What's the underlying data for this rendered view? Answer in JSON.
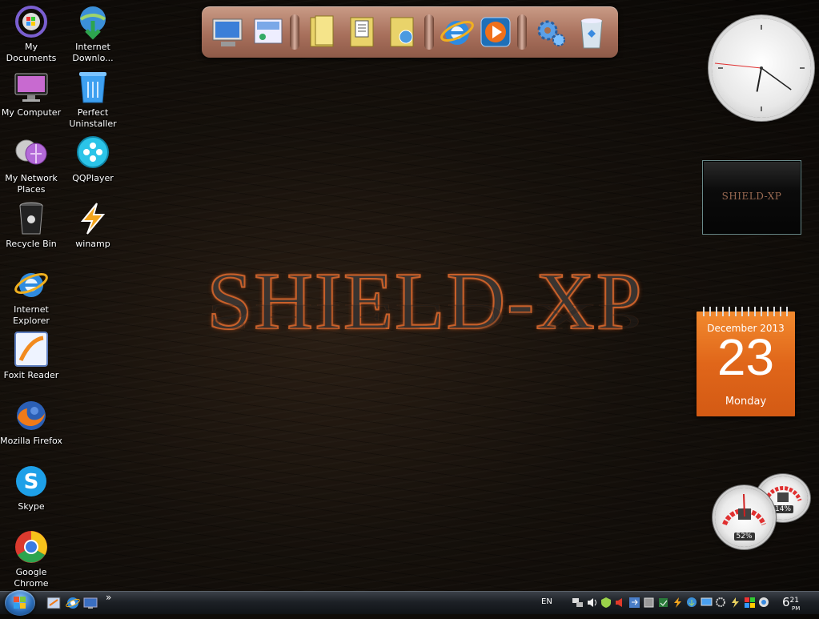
{
  "desktop": {
    "icons_left": [
      {
        "label": "My Documents",
        "icon": "my-documents-icon"
      },
      {
        "label": "My Computer",
        "icon": "my-computer-icon"
      },
      {
        "label": "My Network Places",
        "icon": "network-places-icon"
      },
      {
        "label": "Recycle Bin",
        "icon": "recycle-bin-icon"
      },
      {
        "label": "Internet Explorer",
        "icon": "internet-explorer-icon"
      },
      {
        "label": "Foxit Reader",
        "icon": "foxit-reader-icon"
      },
      {
        "label": "Mozilla Firefox",
        "icon": "firefox-icon"
      },
      {
        "label": "Skype",
        "icon": "skype-icon"
      },
      {
        "label": "Google Chrome",
        "icon": "chrome-icon"
      }
    ],
    "icons_right": [
      {
        "label": "Internet Downlo...",
        "icon": "internet-download-manager-icon"
      },
      {
        "label": "Perfect Uninstaller",
        "icon": "perfect-uninstaller-icon"
      },
      {
        "label": "QQPlayer",
        "icon": "qqplayer-icon"
      },
      {
        "label": "winamp",
        "icon": "winamp-icon"
      }
    ]
  },
  "wallpaper": {
    "title": "SHIELD-XP"
  },
  "dock": {
    "items": [
      "computer-icon",
      "control-panel-icon",
      "folder-icon",
      "documents-folder-icon",
      "pictures-folder-icon",
      "internet-explorer-icon",
      "media-player-icon",
      "settings-gears-icon",
      "recycle-bin-icon"
    ]
  },
  "gadgets": {
    "slideshow": {
      "text": "SHIELD-XP"
    },
    "calendar": {
      "month": "December 2013",
      "day": "23",
      "weekday": "Monday"
    },
    "meters": {
      "cpu": "52%",
      "memory": "14%"
    },
    "clock": {
      "hour": 6,
      "minute": 21
    }
  },
  "taskbar": {
    "quick_launch": [
      "show-desktop-icon",
      "internet-explorer-icon",
      "desktop-icon"
    ],
    "chevron": "»",
    "language": "EN",
    "time_hour": "6",
    "time_minute": "21",
    "time_ampm": "PM"
  },
  "colors": {
    "accent": "#e0661a",
    "taskbar": "#1d2126"
  }
}
